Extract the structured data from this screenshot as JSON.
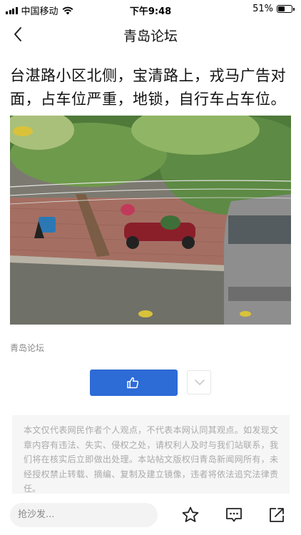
{
  "status_bar": {
    "carrier": "中国移动",
    "time": "下午9:48",
    "battery": "51%",
    "battery_level": 0.51
  },
  "nav": {
    "title": "青岛论坛"
  },
  "article": {
    "title": "台湛路小区北侧，宝清路上，戎马广告对面，占车位严重，地锁，自行车占车位。",
    "source": "青岛论坛"
  },
  "actions": {
    "like_icon": "thumbs-up-icon",
    "more_icon": "chevron-down-icon"
  },
  "disclaimer": "本文仅代表网民作者个人观点，不代表本网认同其观点。如发现文章内容有违法、失实、侵权之处，请权利人及时与我们站联系，我们将在核实后立即做出处理。本站帖文版权归青岛新闻网所有，未经授权禁止转载、摘编、复制及建立镜像，违者将依法追究法律责任。",
  "bottom_bar": {
    "comment_placeholder": "抢沙发...",
    "icons": [
      "star-icon",
      "comment-icon",
      "share-icon"
    ]
  }
}
